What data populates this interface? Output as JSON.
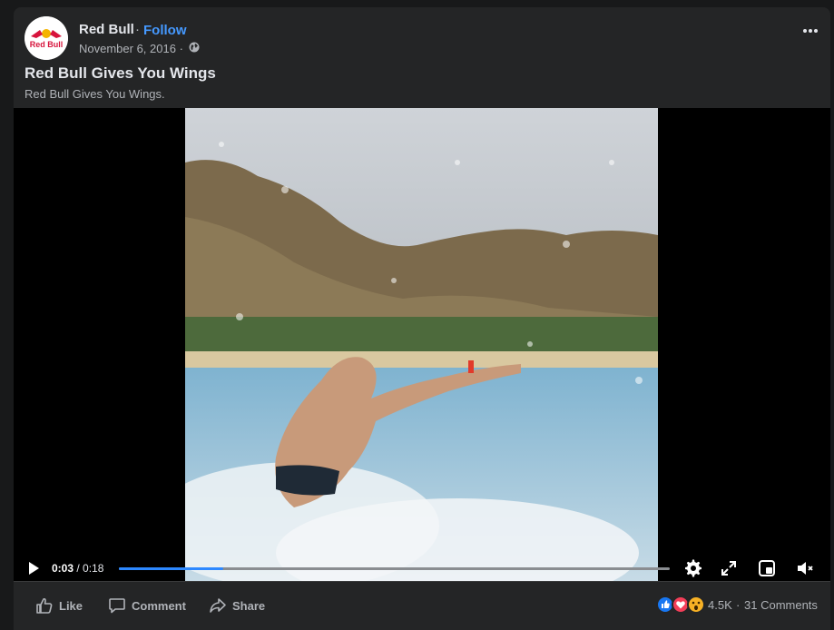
{
  "post": {
    "page_name": "Red Bull",
    "separator": "·",
    "follow_label": "Follow",
    "date": "November 6, 2016 ·",
    "title": "Red Bull Gives You Wings",
    "description": "Red Bull Gives You Wings.",
    "avatar_text": "Red Bull",
    "privacy_icon": "globe-icon"
  },
  "video": {
    "current_time": "0:03",
    "duration": " / 0:18",
    "progress": 0.19
  },
  "actions": {
    "like_label": "Like",
    "comment_label": "Comment",
    "share_label": "Share",
    "reaction_count": "4.5K",
    "separator": "·",
    "comments_count": "31 Comments",
    "reactions": [
      "like",
      "love",
      "wow"
    ]
  },
  "colors": {
    "accent": "#2d88ff",
    "follow": "#4599ff",
    "background": "#18191a",
    "card": "#242526"
  }
}
